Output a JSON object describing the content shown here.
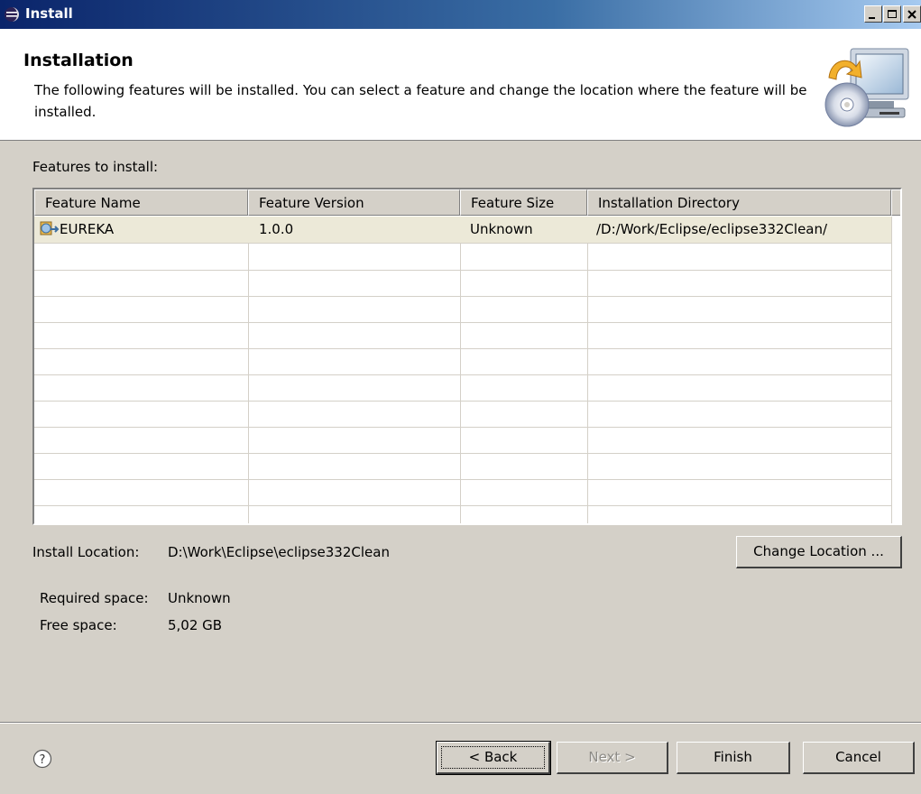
{
  "window": {
    "title": "Install",
    "controls": [
      "minimize",
      "maximize",
      "close"
    ]
  },
  "header": {
    "title": "Installation",
    "description": "The following features will be installed. You can select a feature and change the location where the feature will be installed.",
    "icon": "install-computer-cd-icon"
  },
  "features": {
    "label": "Features to install:",
    "columns": [
      "Feature Name",
      "Feature Version",
      "Feature Size",
      "Installation Directory"
    ],
    "rows": [
      {
        "icon": "feature-icon",
        "name": "EUREKA",
        "version": "1.0.0",
        "size": "Unknown",
        "directory": "/D:/Work/Eclipse/eclipse332Clean/"
      }
    ]
  },
  "location": {
    "label": "Install Location:",
    "value": "D:\\Work\\Eclipse\\eclipse332Clean",
    "change_button": "Change Location ..."
  },
  "space": {
    "required_label": "Required space:",
    "required_value": "Unknown",
    "free_label": "Free space:",
    "free_value": "5,02 GB"
  },
  "buttons": {
    "back": "< Back",
    "next": "Next >",
    "finish": "Finish",
    "cancel": "Cancel"
  },
  "colors": {
    "titlebar_start": "#0a246a",
    "titlebar_end": "#a6caf0",
    "dialog_bg": "#d4d0c8",
    "selected_row": "#ece9d8"
  }
}
